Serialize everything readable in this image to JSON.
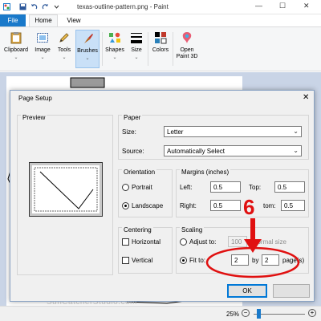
{
  "app": {
    "title": "texas-outline-pattern.png - Paint",
    "window_controls": [
      "—",
      "☐",
      "✕"
    ]
  },
  "ribbon_tabs": {
    "file": "File",
    "home": "Home",
    "view": "View"
  },
  "ribbon": {
    "clipboard": "Clipboard",
    "image": "Image",
    "tools": "Tools",
    "brushes": "Brushes",
    "shapes": "Shapes",
    "size": "Size",
    "colors": "Colors",
    "paint3d_line1": "Open",
    "paint3d_line2": "Paint 3D"
  },
  "status": {
    "zoom": "25%",
    "minus": "−",
    "plus": "+"
  },
  "watermark": "SunCatcherStudio.com",
  "dialog": {
    "title": "Page Setup",
    "close": "✕",
    "preview_title": "Preview",
    "paper": {
      "title": "Paper",
      "size_label": "Size:",
      "size_value": "Letter",
      "source_label": "Source:",
      "source_value": "Automatically Select"
    },
    "orientation": {
      "title": "Orientation",
      "portrait": "Portrait",
      "landscape": "Landscape",
      "selected": "landscape"
    },
    "margins": {
      "title": "Margins (inches)",
      "left_label": "Left:",
      "left_value": "0.5",
      "top_label": "Top:",
      "top_value": "0.5",
      "right_label": "Right:",
      "right_value": "0.5",
      "bottom_label": "tom:",
      "bottom_value": "0.5"
    },
    "centering": {
      "title": "Centering",
      "horizontal": "Horizontal",
      "vertical": "Vertical"
    },
    "scaling": {
      "title": "Scaling",
      "adjust_label": "Adjust to:",
      "adjust_value": "100",
      "adjust_suffix": "normal size",
      "fit_label": "Fit to:",
      "fit_wide": "2",
      "by_label": "by",
      "fit_tall": "2",
      "pages_label": "page(s)"
    },
    "ok": "OK"
  },
  "annotation": {
    "step_number": "6",
    "color": "#e01010"
  },
  "colors": {
    "accent": "#1979ca",
    "canvas_bg": "#c9d4e6",
    "dialog_bg": "#f0f0f0"
  }
}
